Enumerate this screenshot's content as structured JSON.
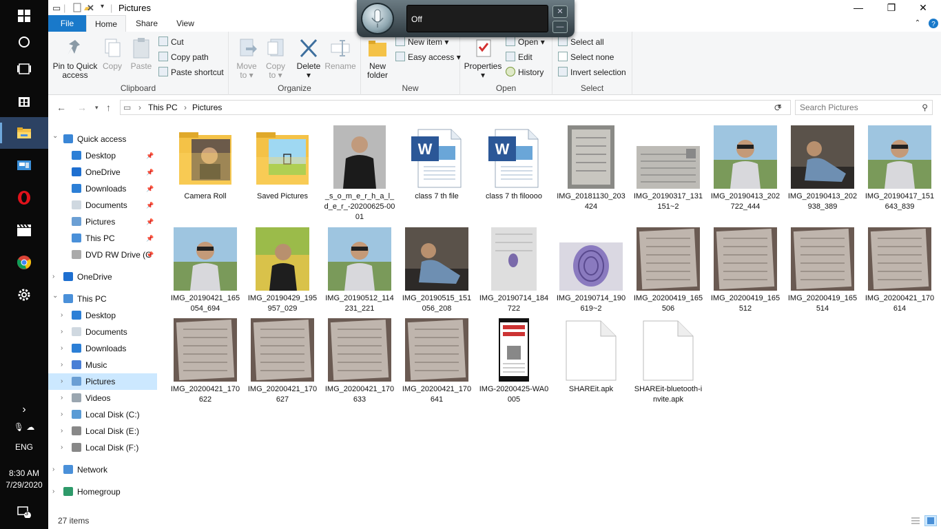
{
  "taskbar": {
    "time": "8:30 AM",
    "date": "7/29/2020",
    "lang": "ENG",
    "notif_count": "3"
  },
  "window": {
    "title": "Pictures",
    "close_glyph": "✕",
    "max_glyph": "❐",
    "min_glyph": "—"
  },
  "tabs": [
    "File",
    "Home",
    "Share",
    "View"
  ],
  "ribbon": {
    "clipboard": {
      "pin": "Pin to Quick access",
      "copy": "Copy",
      "paste": "Paste",
      "cut": "Cut",
      "copy_path": "Copy path",
      "paste_shortcut": "Paste shortcut",
      "label": "Clipboard"
    },
    "organize": {
      "move_to": "Move to",
      "copy_to": "Copy to",
      "delete": "Delete",
      "rename": "Rename",
      "label": "Organize"
    },
    "new": {
      "new_folder": "New folder",
      "new_item": "New item",
      "easy_access": "Easy access",
      "label": "New"
    },
    "open": {
      "properties": "Properties",
      "open": "Open",
      "edit": "Edit",
      "history": "History",
      "label": "Open"
    },
    "select": {
      "select_all": "Select all",
      "select_none": "Select none",
      "invert": "Invert selection",
      "label": "Select"
    }
  },
  "address": {
    "crumbs": [
      "This PC",
      "Pictures"
    ],
    "search_placeholder": "Search Pictures"
  },
  "nav": {
    "quick_access": "Quick access",
    "quick_items": [
      "Desktop",
      "OneDrive",
      "Downloads",
      "Documents",
      "Pictures",
      "This PC",
      "DVD RW Drive (G"
    ],
    "onedrive": "OneDrive",
    "this_pc": "This PC",
    "pc_items": [
      "Desktop",
      "Documents",
      "Downloads",
      "Music",
      "Pictures",
      "Videos",
      "Local Disk (C:)",
      "Local Disk (E:)",
      "Local Disk (F:)"
    ],
    "network": "Network",
    "homegroup": "Homegroup"
  },
  "files": [
    {
      "name": "Camera Roll",
      "kind": "folder-photo"
    },
    {
      "name": "Saved Pictures",
      "kind": "folder-saved"
    },
    {
      "name": "_s_o_m_e_r_h_a_l_d_e_r_-20200625-0001",
      "kind": "photo-dark"
    },
    {
      "name": "class 7 th file",
      "kind": "word"
    },
    {
      "name": "class 7 th filoooo",
      "kind": "word"
    },
    {
      "name": "IMG_20181130_203424",
      "kind": "photo-doc"
    },
    {
      "name": "IMG_20190317_131151~2",
      "kind": "photo-doc-wide"
    },
    {
      "name": "IMG_20190413_202722_444",
      "kind": "photo-person"
    },
    {
      "name": "IMG_20190413_202938_389",
      "kind": "photo-person-dark"
    },
    {
      "name": "IMG_20190417_151643_839",
      "kind": "photo-person"
    },
    {
      "name": "IMG_20190421_165054_694",
      "kind": "photo-person"
    },
    {
      "name": "IMG_20190429_195957_029",
      "kind": "photo-person-yellow"
    },
    {
      "name": "IMG_20190512_114231_221",
      "kind": "photo-person"
    },
    {
      "name": "IMG_20190515_151056_208",
      "kind": "photo-person-dark"
    },
    {
      "name": "IMG_20190714_184722",
      "kind": "photo-finger"
    },
    {
      "name": "IMG_20190714_190619~2",
      "kind": "photo-finger-wide"
    },
    {
      "name": "IMG_20200419_165506",
      "kind": "photo-notes"
    },
    {
      "name": "IMG_20200419_165512",
      "kind": "photo-notes"
    },
    {
      "name": "IMG_20200419_165514",
      "kind": "photo-notes"
    },
    {
      "name": "IMG_20200421_170614",
      "kind": "photo-notes"
    },
    {
      "name": "IMG_20200421_170622",
      "kind": "photo-notes"
    },
    {
      "name": "IMG_20200421_170627",
      "kind": "photo-notes"
    },
    {
      "name": "IMG_20200421_170633",
      "kind": "photo-notes"
    },
    {
      "name": "IMG_20200421_170641",
      "kind": "photo-notes"
    },
    {
      "name": "IMG-20200425-WA0005",
      "kind": "photo-news"
    },
    {
      "name": "SHAREit.apk",
      "kind": "blank"
    },
    {
      "name": "SHAREit-bluetooth-invite.apk",
      "kind": "blank"
    }
  ],
  "status": {
    "count": "27 items"
  },
  "voice": {
    "state": "Off"
  }
}
